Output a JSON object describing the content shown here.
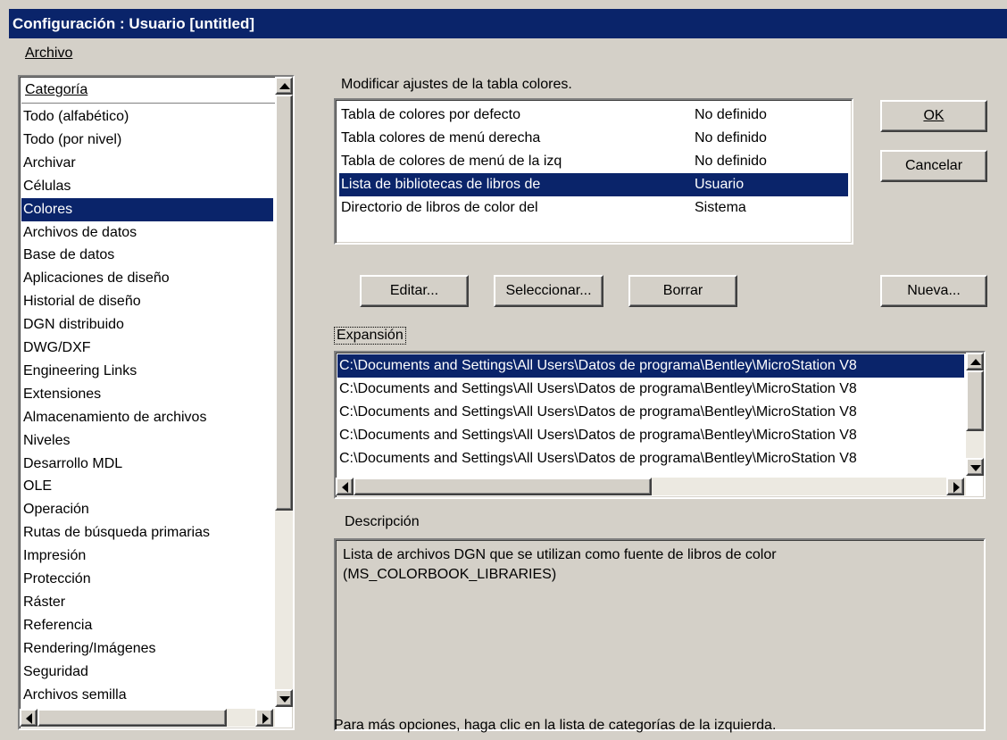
{
  "window": {
    "title": "Configuración : Usuario [untitled]"
  },
  "menu": {
    "archivo": "Archivo"
  },
  "categories": {
    "header": "Categoría",
    "items": [
      "Todo (alfabético)",
      "Todo (por nivel)",
      "Archivar",
      "Células",
      "Colores",
      "Archivos de datos",
      "Base de datos",
      "Aplicaciones de diseño",
      "Historial de diseño",
      "DGN distribuido",
      "DWG/DXF",
      "Engineering Links",
      "Extensiones",
      "Almacenamiento de archivos",
      "Niveles",
      "Desarrollo MDL",
      "OLE",
      "Operación",
      "Rutas de búsqueda primarias",
      "Impresión",
      "Protección",
      "Ráster",
      "Referencia",
      "Rendering/Imágenes",
      "Seguridad",
      "Archivos semilla"
    ],
    "selected": "Colores"
  },
  "settings": {
    "heading": "Modificar ajustes de la tabla colores.",
    "rows": [
      {
        "name": "Tabla de colores por defecto",
        "value": "No definido"
      },
      {
        "name": "Tabla colores de menú derecha",
        "value": "No definido"
      },
      {
        "name": "Tabla de colores de menú de la izq",
        "value": "No definido"
      },
      {
        "name": "Lista de bibliotecas de libros de",
        "value": "Usuario"
      },
      {
        "name": "Directorio de libros de color del",
        "value": "Sistema"
      }
    ],
    "selected_index": 3
  },
  "buttons": {
    "ok": "OK",
    "cancel": "Cancelar",
    "edit": "Editar...",
    "select": "Seleccionar...",
    "delete": "Borrar",
    "new": "Nueva..."
  },
  "expansion": {
    "label": "Expansión",
    "rows": [
      "C:\\Documents and Settings\\All Users\\Datos de programa\\Bentley\\MicroStation V8",
      "C:\\Documents and Settings\\All Users\\Datos de programa\\Bentley\\MicroStation V8",
      "C:\\Documents and Settings\\All Users\\Datos de programa\\Bentley\\MicroStation V8",
      "C:\\Documents and Settings\\All Users\\Datos de programa\\Bentley\\MicroStation V8",
      "C:\\Documents and Settings\\All Users\\Datos de programa\\Bentley\\MicroStation V8"
    ]
  },
  "description": {
    "label": "Descripción",
    "text_line1": "Lista de archivos DGN que se utilizan como fuente de libros de color",
    "text_line2": "(MS_COLORBOOK_LIBRARIES)"
  },
  "footer": {
    "hint": "Para más opciones, haga clic en la lista de categorías de la izquierda."
  },
  "colors": {
    "selection": "#0a246a",
    "face": "#d4d0c8"
  }
}
